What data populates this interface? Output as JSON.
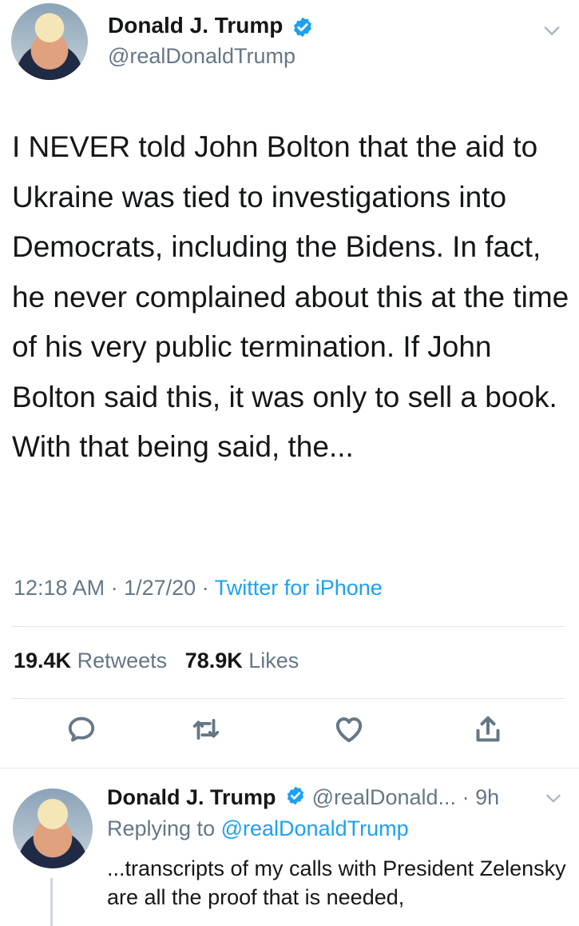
{
  "tweet": {
    "author_name": "Donald J. Trump",
    "handle": "@realDonaldTrump",
    "text": "I NEVER told John Bolton that the aid to Ukraine was tied to investigations into Democrats, including the Bidens. In fact, he never complained about this at the time of his very public termination. If John Bolton said this, it was only to sell a book. With that being said, the...",
    "time": "12:18 AM",
    "date": "1/27/20",
    "source": "Twitter for iPhone",
    "retweets_count": "19.4K",
    "retweets_label": "Retweets",
    "likes_count": "78.9K",
    "likes_label": "Likes"
  },
  "reply": {
    "author_name": "Donald J. Trump",
    "handle": "@realDonald...",
    "time_ago": "9h",
    "replying_prefix": "Replying to",
    "replying_to": "@realDonaldTrump",
    "text": "...transcripts of my calls with President Zelensky are all the proof that is needed,"
  },
  "separators": {
    "dot": "·"
  },
  "icons": {
    "verified": "verified-badge-icon",
    "menu": "chevron-down-icon",
    "reply": "comment-icon",
    "retweet": "retweet-icon",
    "like": "heart-icon",
    "share": "share-icon"
  },
  "colors": {
    "link": "#1da1f2",
    "secondary_text": "#657786",
    "primary_text": "#14171a",
    "divider": "#e1e8ed"
  }
}
